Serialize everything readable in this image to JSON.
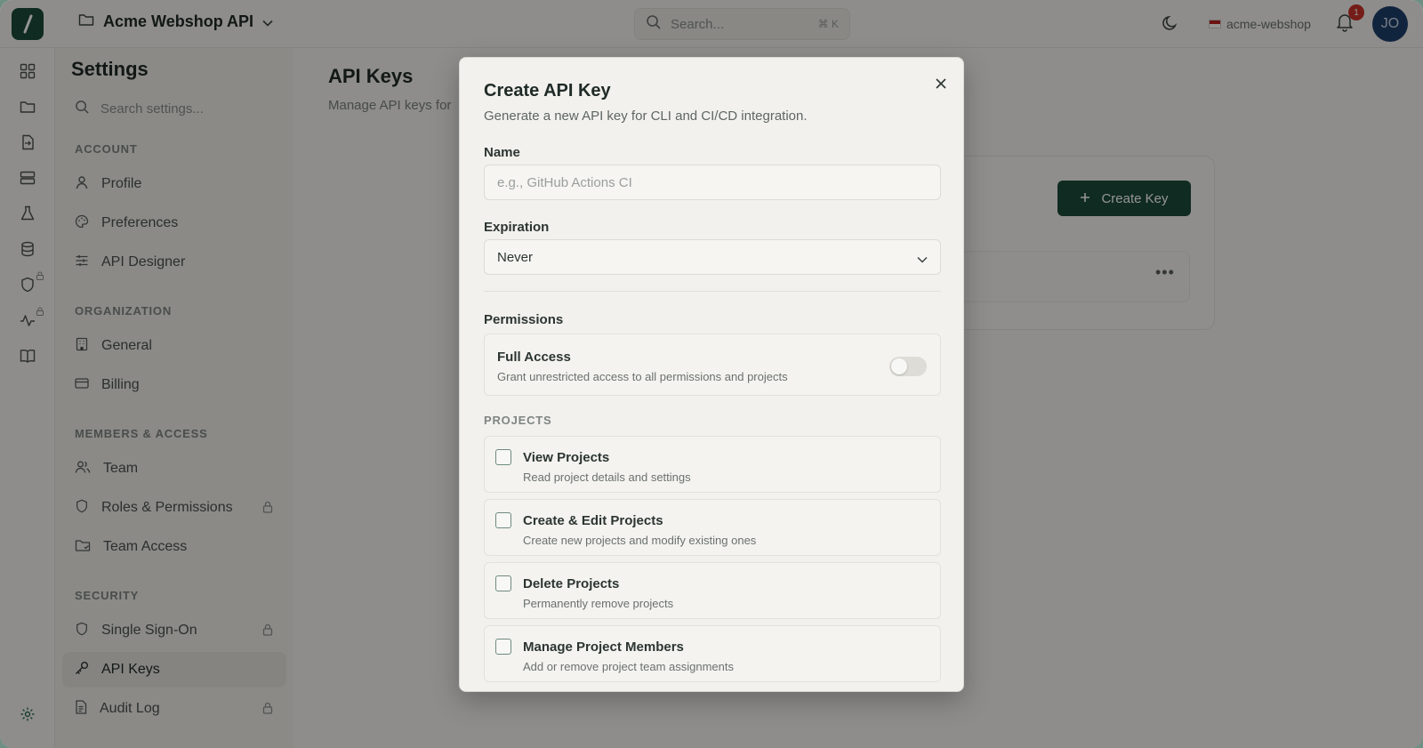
{
  "app": {
    "project_name": "Acme Webshop API",
    "search_placeholder": "Search...",
    "search_shortcut": "⌘ K",
    "org_name": "acme-webshop",
    "notification_count": "1",
    "user_initials": "JO"
  },
  "sidebar": {
    "title": "Settings",
    "search_placeholder": "Search settings...",
    "sections": {
      "account": "ACCOUNT",
      "organization": "ORGANIZATION",
      "members": "MEMBERS & ACCESS",
      "security": "SECURITY"
    },
    "items": {
      "profile": "Profile",
      "preferences": "Preferences",
      "api_designer": "API Designer",
      "general": "General",
      "billing": "Billing",
      "team": "Team",
      "roles": "Roles & Permissions",
      "team_access": "Team Access",
      "sso": "Single Sign-On",
      "api_keys": "API Keys",
      "audit_log": "Audit Log"
    }
  },
  "main": {
    "title": "API Keys",
    "subtitle": "Manage API keys for",
    "create_key_label": "Create Key",
    "more_label": "•••"
  },
  "modal": {
    "title": "Create API Key",
    "description": "Generate a new API key for CLI and CI/CD integration.",
    "name_label": "Name",
    "name_placeholder": "e.g., GitHub Actions CI",
    "expiration_label": "Expiration",
    "expiration_value": "Never",
    "permissions_label": "Permissions",
    "full_access_title": "Full Access",
    "full_access_desc": "Grant unrestricted access to all permissions and projects",
    "full_access_enabled": false,
    "projects_header": "PROJECTS",
    "permissions": [
      {
        "title": "View Projects",
        "desc": "Read project details and settings",
        "checked": false
      },
      {
        "title": "Create & Edit Projects",
        "desc": "Create new projects and modify existing ones",
        "checked": false
      },
      {
        "title": "Delete Projects",
        "desc": "Permanently remove projects",
        "checked": false
      },
      {
        "title": "Manage Project Members",
        "desc": "Add or remove project team assignments",
        "checked": false
      }
    ]
  }
}
